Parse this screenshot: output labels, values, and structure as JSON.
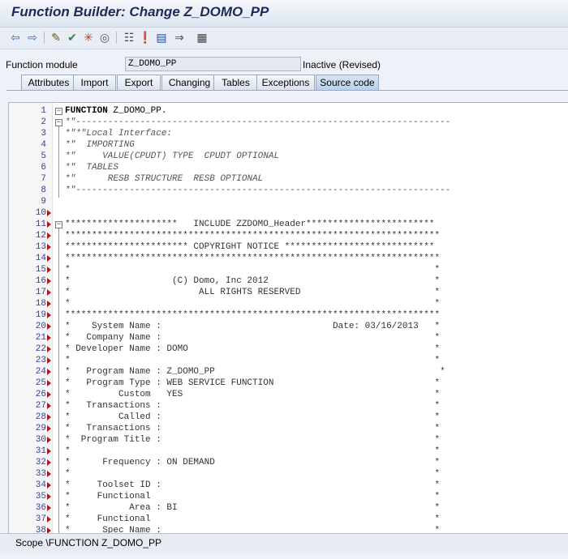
{
  "window": {
    "title": "Function Builder: Change Z_DOMO_PP"
  },
  "toolbar": {
    "icons": [
      "back-arrow-icon",
      "forward-arrow-icon",
      "display-change-icon",
      "check-icon",
      "activate-icon",
      "where-used-icon",
      "object-list-icon",
      "breakpoint-icon",
      "test-icon",
      "navigate-icon",
      "hierarchy-icon"
    ]
  },
  "function_module": {
    "label": "Function module",
    "value": "Z_DOMO_PP",
    "status": "Inactive (Revised)"
  },
  "tabs": [
    "Attributes",
    "Import",
    "Export",
    "Changing",
    "Tables",
    "Exceptions",
    "Source code"
  ],
  "active_tab": "Source code",
  "editor": {
    "lines": [
      {
        "n": "1",
        "text": "FUNCTION Z_DOMO_PP."
      },
      {
        "n": "2",
        "text": "*\"----------------------------------------------------------------------"
      },
      {
        "n": "3",
        "text": "*\"*\"Local Interface:"
      },
      {
        "n": "4",
        "text": "*\"  IMPORTING"
      },
      {
        "n": "5",
        "text": "*\"     VALUE(CPUDT) TYPE  CPUDT OPTIONAL"
      },
      {
        "n": "6",
        "text": "*\"  TABLES"
      },
      {
        "n": "7",
        "text": "*\"      RESB STRUCTURE  RESB OPTIONAL"
      },
      {
        "n": "8",
        "text": "*\"----------------------------------------------------------------------"
      },
      {
        "n": "9",
        "text": ""
      },
      {
        "n": "10",
        "text": ""
      },
      {
        "n": "11",
        "text": "*********************   INCLUDE ZZDOMO_Header************************"
      },
      {
        "n": "12",
        "text": "**********************************************************************"
      },
      {
        "n": "13",
        "text": "*********************** COPYRIGHT NOTICE ****************************"
      },
      {
        "n": "14",
        "text": "**********************************************************************"
      },
      {
        "n": "15",
        "text": "*                                                                    *"
      },
      {
        "n": "16",
        "text": "*                   (C) Domo, Inc 2012                               *"
      },
      {
        "n": "17",
        "text": "*                        ALL RIGHTS RESERVED                         *"
      },
      {
        "n": "18",
        "text": "*                                                                    *"
      },
      {
        "n": "19",
        "text": "**********************************************************************"
      },
      {
        "n": "20",
        "text": "*    System Name :                                Date: 03/16/2013   *"
      },
      {
        "n": "21",
        "text": "*   Company Name :                                                   *"
      },
      {
        "n": "22",
        "text": "* Developer Name : DOMO                                              *"
      },
      {
        "n": "23",
        "text": "*                                                                    *"
      },
      {
        "n": "24",
        "text": "*   Program Name : Z_DOMO_PP                                          *"
      },
      {
        "n": "25",
        "text": "*   Program Type : WEB SERVICE FUNCTION                              *"
      },
      {
        "n": "26",
        "text": "*         Custom   YES                                               *"
      },
      {
        "n": "27",
        "text": "*   Transactions :                                                   *"
      },
      {
        "n": "28",
        "text": "*         Called :                                                   *"
      },
      {
        "n": "29",
        "text": "*   Transactions :                                                   *"
      },
      {
        "n": "30",
        "text": "*  Program Title :                                                   *"
      },
      {
        "n": "31",
        "text": "*                                                                    *"
      },
      {
        "n": "32",
        "text": "*      Frequency : ON DEMAND                                         *"
      },
      {
        "n": "33",
        "text": "*                                                                    *"
      },
      {
        "n": "34",
        "text": "*     Toolset ID :                                                   *"
      },
      {
        "n": "35",
        "text": "*     Functional                                                     *"
      },
      {
        "n": "36",
        "text": "*           Area : BI                                                *"
      },
      {
        "n": "37",
        "text": "*     Functional                                                     *"
      },
      {
        "n": "38",
        "text": "*      Spec Name :                                                   *"
      }
    ]
  },
  "status_bar": {
    "text": "Scope \\FUNCTION Z_DOMO_PP"
  }
}
